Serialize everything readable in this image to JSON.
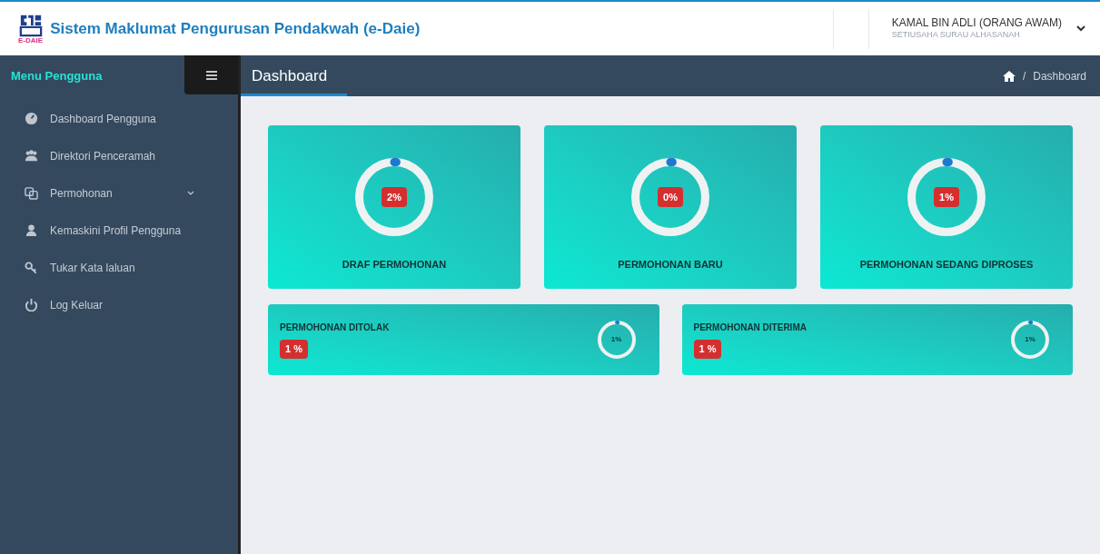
{
  "header": {
    "logo_text": "E-DAIE",
    "title": "Sistem Maklumat Pengurusan Pendakwah (e-Daie)",
    "user": {
      "name": "KAMAL BIN ADLI (ORANG AWAM)",
      "role": "SETIUSAHA SURAU ALHASANAH"
    }
  },
  "sidebar": {
    "title": "Menu Pengguna",
    "items": [
      {
        "label": "Dashboard Pengguna",
        "kind": "link"
      },
      {
        "label": "Direktori Penceramah",
        "kind": "link"
      },
      {
        "label": "Permohonan",
        "kind": "submenu"
      },
      {
        "label": "Kemaskini Profil Pengguna",
        "kind": "link"
      },
      {
        "label": "Tukar Kata laluan",
        "kind": "link"
      },
      {
        "label": "Log Keluar",
        "kind": "link"
      }
    ]
  },
  "page": {
    "title": "Dashboard",
    "breadcrumb_separator": "/",
    "breadcrumb": "Dashboard"
  },
  "summary_cards": [
    {
      "label": "DRAF PERMOHONAN",
      "badge": "2%"
    },
    {
      "label": "PERMOHONAN BARU",
      "badge": "0%"
    },
    {
      "label": "PERMOHONAN SEDANG DIPROSES",
      "badge": "1%"
    }
  ],
  "status_cards": [
    {
      "label": "PERMOHONAN DITOLAK",
      "badge": "1 %",
      "ring_text": "1%"
    },
    {
      "label": "PERMOHONAN DITERIMA",
      "badge": "1 %",
      "ring_text": "1%"
    }
  ]
}
